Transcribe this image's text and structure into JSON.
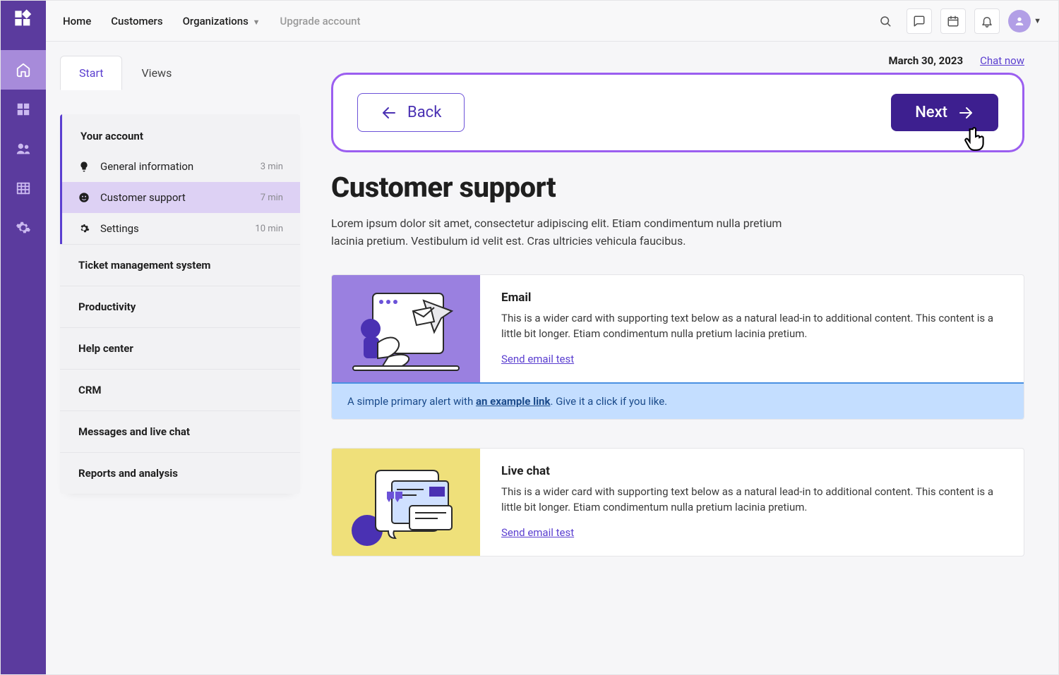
{
  "topnav": {
    "items": [
      "Home",
      "Customers",
      "Organizations"
    ],
    "upgrade": "Upgrade account"
  },
  "header": {
    "date": "March 30, 2023",
    "chat_now": "Chat now"
  },
  "tabs": {
    "start": "Start",
    "views": "Views"
  },
  "sidebar": {
    "section_title": "Your account",
    "rows": [
      {
        "icon": "bulb",
        "label": "General information",
        "meta": "3 min"
      },
      {
        "icon": "support",
        "label": "Customer support",
        "meta": "7 min"
      },
      {
        "icon": "gear",
        "label": "Settings",
        "meta": "10 min"
      }
    ],
    "other": [
      "Ticket management system",
      "Productivity",
      "Help center",
      "CRM",
      "Messages and live chat",
      "Reports and analysis"
    ]
  },
  "nav_panel": {
    "back": "Back",
    "next": "Next"
  },
  "page": {
    "title": "Customer support",
    "desc": "Lorem ipsum dolor sit amet, consectetur adipiscing elit. Etiam condimentum nulla pretium lacinia pretium. Vestibulum id velit est. Cras ultricies vehicula faucibus."
  },
  "cards": [
    {
      "title": "Email",
      "body": "This is a wider card with supporting text below as a natural lead-in to additional content. This content is a little bit longer.  Etiam condimentum nulla pretium lacinia pretium.",
      "link": "Send email test",
      "alert_pre": "A simple primary alert with ",
      "alert_link": "an example link",
      "alert_post": ". Give it a click if you like."
    },
    {
      "title": "Live chat",
      "body": "This is a wider card with supporting text below as a natural lead-in to additional content. This content is a little bit longer.  Etiam condimentum nulla pretium lacinia pretium.",
      "link": "Send email test"
    }
  ]
}
